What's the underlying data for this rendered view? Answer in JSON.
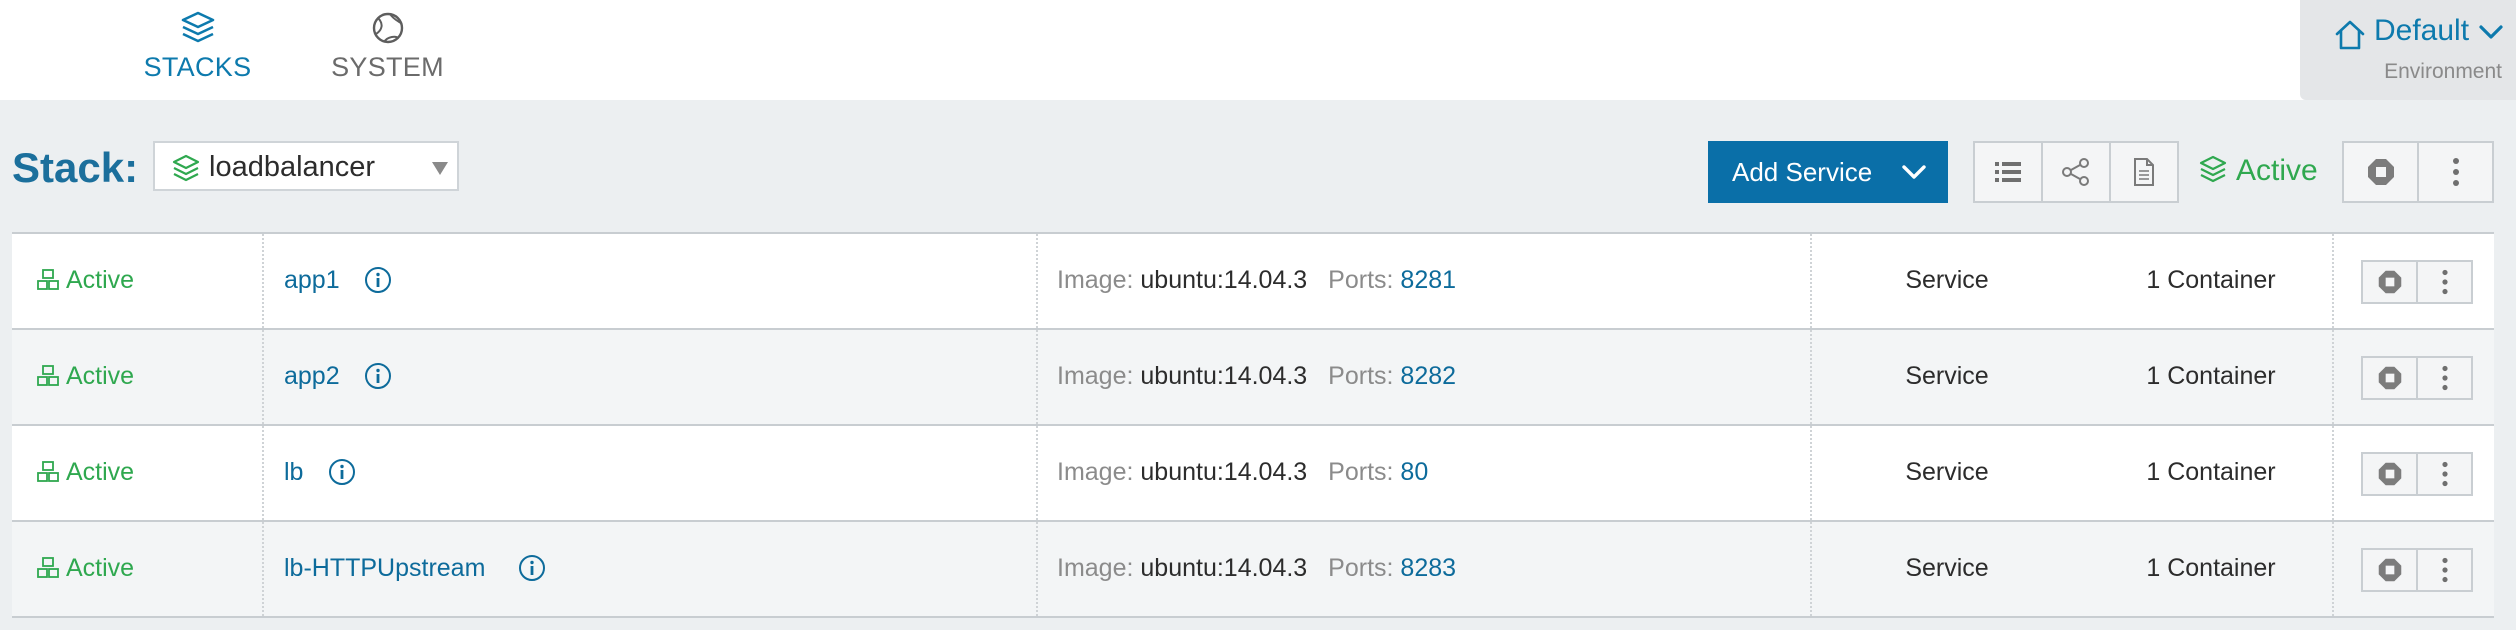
{
  "nav": {
    "tabs": [
      {
        "label": "STACKS",
        "icon": "layers-icon",
        "active": true
      },
      {
        "label": "SYSTEM",
        "icon": "globe-icon",
        "active": false
      }
    ]
  },
  "environment": {
    "name": "Default",
    "label": "Environment",
    "icon": "home-icon"
  },
  "stack": {
    "label": "Stack:",
    "selected": "loadbalancer",
    "add_service_label": "Add Service",
    "state": "Active",
    "view_buttons": [
      "list-view-icon",
      "graph-view-icon",
      "config-file-icon"
    ]
  },
  "services": [
    {
      "state": "Active",
      "name": "app1",
      "image_label": "Image:",
      "image": "ubuntu:14.04.3",
      "ports_label": "Ports:",
      "ports": "8281",
      "kind": "Service",
      "containers": "1 Container"
    },
    {
      "state": "Active",
      "name": "app2",
      "image_label": "Image:",
      "image": "ubuntu:14.04.3",
      "ports_label": "Ports:",
      "ports": "8282",
      "kind": "Service",
      "containers": "1 Container"
    },
    {
      "state": "Active",
      "name": "lb",
      "image_label": "Image:",
      "image": "ubuntu:14.04.3",
      "ports_label": "Ports:",
      "ports": "80",
      "kind": "Service",
      "containers": "1 Container"
    },
    {
      "state": "Active",
      "name": "lb-HTTPUpstream",
      "image_label": "Image:",
      "image": "ubuntu:14.04.3",
      "ports_label": "Ports:",
      "ports": "8283",
      "kind": "Service",
      "containers": "1 Container"
    }
  ],
  "colors": {
    "accent": "#0d7aad",
    "button": "#0a6fa8",
    "active": "#2fa84f",
    "background": "#eceff1"
  }
}
